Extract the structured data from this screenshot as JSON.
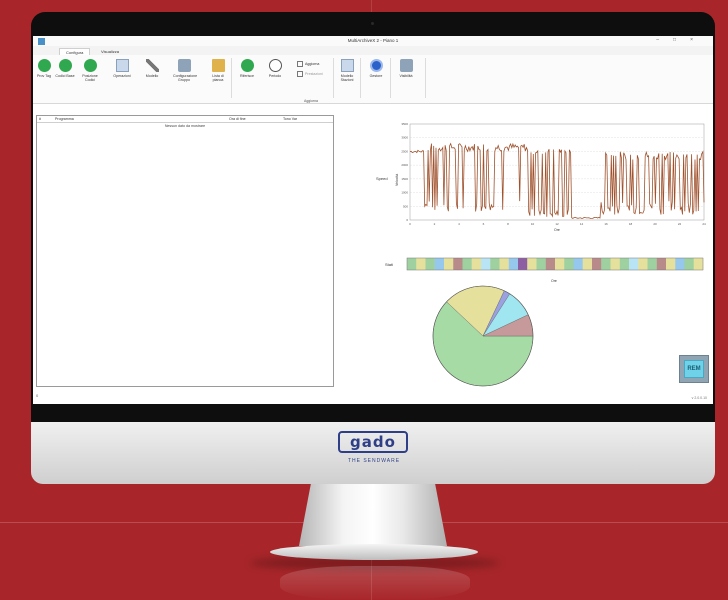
{
  "window": {
    "title": "MultiArchiveX 2 - Piano 1",
    "controls": [
      "–",
      "□",
      "×"
    ]
  },
  "tabs": [
    {
      "label": "Configura",
      "active": true
    },
    {
      "label": "Visualizza",
      "active": false
    }
  ],
  "ribbon": {
    "buttons": [
      {
        "label": "Prov Tag",
        "icon": "green-circle-icon"
      },
      {
        "label": "Codici Base",
        "icon": "green-circle-icon"
      },
      {
        "label": "Posizione Codici",
        "icon": "green-circle-icon"
      },
      {
        "label": "Operazioni",
        "icon": "document-icon"
      },
      {
        "label": "Modello",
        "icon": "tools-icon"
      },
      {
        "label": "Configurazione Gruppo",
        "icon": "gear-icon"
      },
      {
        "label": "Lista di pianoa",
        "icon": "folder-icon"
      },
      {
        "label": "Riferisce",
        "icon": "play-icon"
      },
      {
        "label": "Periodo",
        "icon": "clock-icon"
      },
      {
        "label": "Modello Stazioni",
        "icon": "document-icon"
      },
      {
        "label": "Gestore",
        "icon": "blue-circle-icon"
      },
      {
        "label": "Visibilità",
        "icon": "gear-icon"
      }
    ],
    "checkboxes": [
      {
        "label": "Aggiorna",
        "checked": false
      },
      {
        "label": "Prestazioni",
        "checked": false
      }
    ],
    "group_label": "Aggiorna"
  },
  "program_list": {
    "columns": [
      "#",
      "Programma",
      "Ora di fine",
      "Tono Var"
    ],
    "empty_text": "Nessun dato da mostrare"
  },
  "charts_labels": {
    "timeline_ylabel": "Speed",
    "timeline_axis": "Velocità",
    "timeline_xlabel": "Ore",
    "bar_label": "Stati",
    "bar_xlabel": "Ore"
  },
  "chart_data": [
    {
      "type": "line",
      "ylabel": "Velocità",
      "xlabel": "Ore",
      "ylim": [
        0,
        3500
      ],
      "y_ticks": [
        0,
        500,
        1000,
        1500,
        2000,
        2500,
        3000,
        3500
      ],
      "x_ticks": [
        0,
        2,
        4,
        6,
        8,
        10,
        12,
        14,
        16,
        18,
        20,
        22,
        24
      ],
      "grid": true,
      "color": "#a0522d"
    },
    {
      "type": "bar",
      "colors": [
        "#9fd0a0",
        "#e5e19c",
        "#b98a8a",
        "#95c8ec",
        "#b9e4f5",
        "#8e5ea2"
      ]
    },
    {
      "type": "pie",
      "slices": [
        {
          "value": 62,
          "color": "#a6dba6"
        },
        {
          "value": 20,
          "color": "#e5e19c"
        },
        {
          "value": 2,
          "color": "#9aa0e0"
        },
        {
          "value": 9,
          "color": "#a0e6f0"
        },
        {
          "value": 7,
          "color": "#c69a9a"
        }
      ]
    }
  ],
  "status": {
    "left": "0",
    "right": "v 2.0.0.10"
  },
  "rem_button": {
    "label": "REM"
  },
  "brand": {
    "logo": "gado",
    "tagline": "THE SENDWARE"
  }
}
